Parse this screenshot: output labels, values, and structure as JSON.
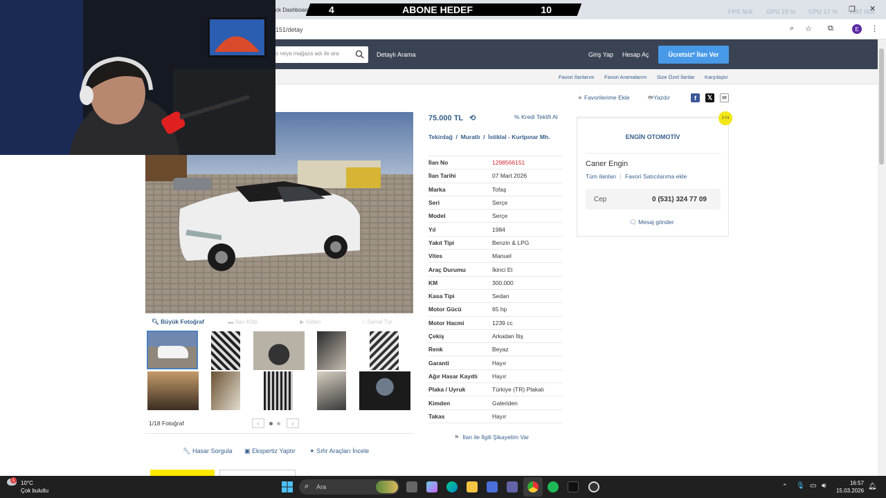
{
  "browser": {
    "tab_title": "ck Dashboard",
    "address": "151/detay",
    "avatar_letter": "E",
    "stats": [
      {
        "label": "FPS",
        "value": "N/A"
      },
      {
        "label": "GPU",
        "value": "23 %"
      },
      {
        "label": "CPU",
        "value": "17 %"
      },
      {
        "label": "RAT",
        "value": "N/A"
      }
    ]
  },
  "overlay": {
    "left_number": "4",
    "title": "ABONE HEDEF",
    "right_number": "10"
  },
  "header": {
    "search_placeholder": "o veya mağaza adı ile ara",
    "detailed_search": "Detaylı Arama",
    "login": "Giriş Yap",
    "register": "Hesap Aç",
    "post_ad": "Ücretsiz* İlan Ver"
  },
  "subnav": [
    "Favori İlanlarım",
    "Favori Aramalarım",
    "Size Özel İlanlar",
    "Karşılaştır"
  ],
  "actions": {
    "favorite": "Favorilerime Ekle",
    "print": "Yazdır"
  },
  "gallery": {
    "tabs": [
      "Büyük Fotoğraf",
      "İlan Klibi",
      "Video",
      "Sanal Tur"
    ],
    "counter": "1/18 Fotoğraf"
  },
  "listing": {
    "price": "75.000 TL",
    "credit": "Kredi Teklifi Al",
    "location": [
      "Tekirdağ",
      "Muratlı",
      "İstiklal - Kurtpınar Mh."
    ],
    "details": [
      {
        "k": "İlan No",
        "v": "1298566151"
      },
      {
        "k": "İlan Tarihi",
        "v": "07 Mart 2026"
      },
      {
        "k": "Marka",
        "v": "Tofaş"
      },
      {
        "k": "Seri",
        "v": "Serçe"
      },
      {
        "k": "Model",
        "v": "Serçe"
      },
      {
        "k": "Yıl",
        "v": "1984"
      },
      {
        "k": "Yakıt Tipi",
        "v": "Benzin & LPG"
      },
      {
        "k": "Vites",
        "v": "Manuel"
      },
      {
        "k": "Araç Durumu",
        "v": "İkinci El"
      },
      {
        "k": "KM",
        "v": "300.000"
      },
      {
        "k": "Kasa Tipi",
        "v": "Sedan"
      },
      {
        "k": "Motor Gücü",
        "v": "65 hp"
      },
      {
        "k": "Motor Hacmi",
        "v": "1239 cc"
      },
      {
        "k": "Çekiş",
        "v": "Arkadan İtiş"
      },
      {
        "k": "Renk",
        "v": "Beyaz"
      },
      {
        "k": "Garanti",
        "v": "Hayır"
      },
      {
        "k": "Ağır Hasar Kayıtlı",
        "v": "Hayır"
      },
      {
        "k": "Plaka / Uyruk",
        "v": "Türkiye (TR) Plakalı"
      },
      {
        "k": "Kimden",
        "v": "Galeriden"
      },
      {
        "k": "Takas",
        "v": "Hayır"
      }
    ],
    "complaint": "İlan ile İlgili Şikayetim Var"
  },
  "seller": {
    "store": "ENGİN OTOMOTİV",
    "badge": "2 Yıl",
    "name": "Caner Engin",
    "all_ads": "Tüm ilanları",
    "fav_seller": "Favori Satıcılarıma ekle",
    "phone_label": "Cep",
    "phone": "0 (531) 324 77 09",
    "message": "Mesaj gönder"
  },
  "bottom_links": [
    "Hasar Sorgula",
    "Ekspertiz Yaptır",
    "Sıfır Araçları İncele"
  ],
  "taskbar": {
    "temp": "10°C",
    "weather": "Çok bulutlu",
    "weather_badge": "1",
    "search": "Ara",
    "time": "16:57",
    "date": "15.03.2026"
  }
}
